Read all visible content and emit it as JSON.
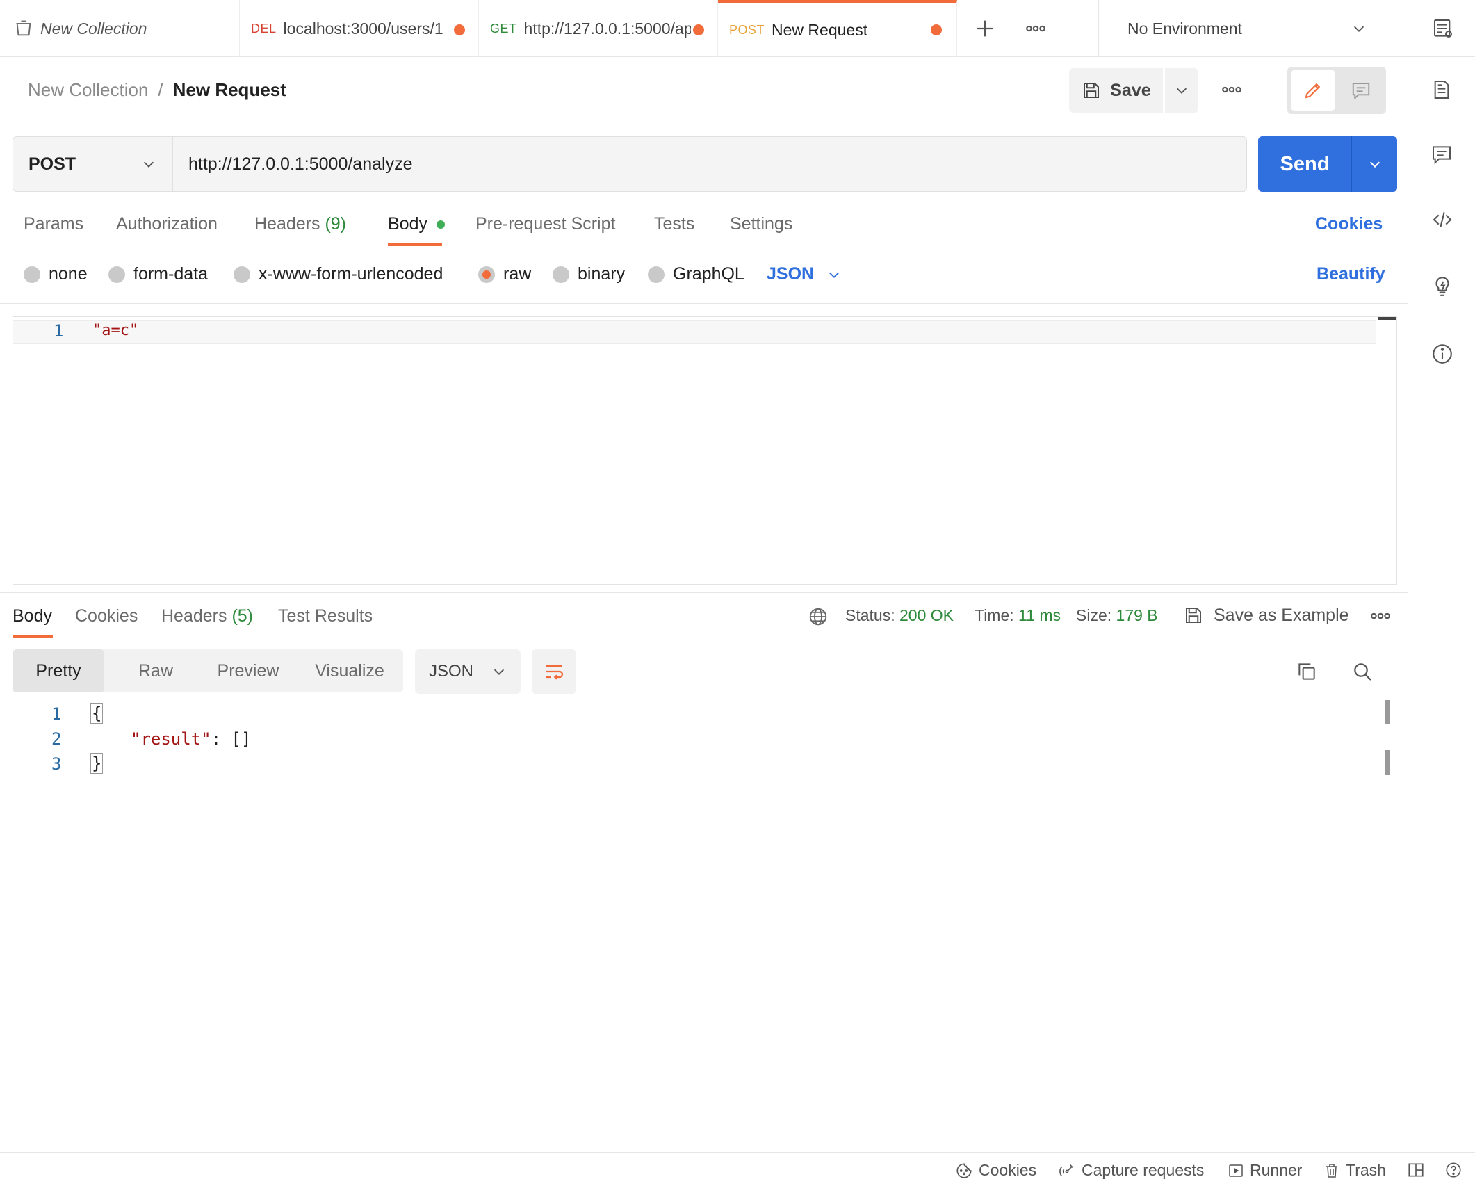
{
  "tabs": [
    {
      "method": "",
      "label": "New Collection"
    },
    {
      "method": "DEL",
      "label": "localhost:3000/users/1"
    },
    {
      "method": "GET",
      "label": "http://127.0.0.1:5000/ap"
    },
    {
      "method": "POST",
      "label": "New Request"
    }
  ],
  "environment": {
    "label": "No Environment"
  },
  "breadcrumb": {
    "collection": "New Collection",
    "separator": "/",
    "request": "New Request"
  },
  "toolbar": {
    "save_label": "Save"
  },
  "request": {
    "method": "POST",
    "url": "http://127.0.0.1:5000/analyze",
    "send_label": "Send",
    "tabs": {
      "params": "Params",
      "authorization": "Authorization",
      "headers": "Headers",
      "headers_count": "(9)",
      "body": "Body",
      "prerequest": "Pre-request Script",
      "tests": "Tests",
      "settings": "Settings"
    },
    "cookies_link": "Cookies",
    "body_types": {
      "none": "none",
      "form_data": "form-data",
      "urlencoded": "x-www-form-urlencoded",
      "raw": "raw",
      "binary": "binary",
      "graphql": "GraphQL",
      "format": "JSON"
    },
    "beautify": "Beautify",
    "editor": {
      "line1_no": "1",
      "line1": "\"a=c\""
    }
  },
  "response": {
    "tabs": {
      "body": "Body",
      "cookies": "Cookies",
      "headers": "Headers",
      "headers_count": "(5)",
      "test_results": "Test Results"
    },
    "status_label": "Status:",
    "status_value": "200 OK",
    "time_label": "Time:",
    "time_value": "11 ms",
    "size_label": "Size:",
    "size_value": "179 B",
    "save_example": "Save as Example",
    "views": {
      "pretty": "Pretty",
      "raw": "Raw",
      "preview": "Preview",
      "visualize": "Visualize"
    },
    "format": "JSON",
    "lines": [
      {
        "no": "1",
        "text": "{"
      },
      {
        "no": "2",
        "key": "\"result\"",
        "rest": ": []"
      },
      {
        "no": "3",
        "text": "}"
      }
    ]
  },
  "footer": {
    "cookies": "Cookies",
    "capture": "Capture requests",
    "runner": "Runner",
    "trash": "Trash"
  },
  "colors": {
    "accent": "#f26b3a",
    "primary": "#2f6fde",
    "success": "#2c8a3a"
  }
}
